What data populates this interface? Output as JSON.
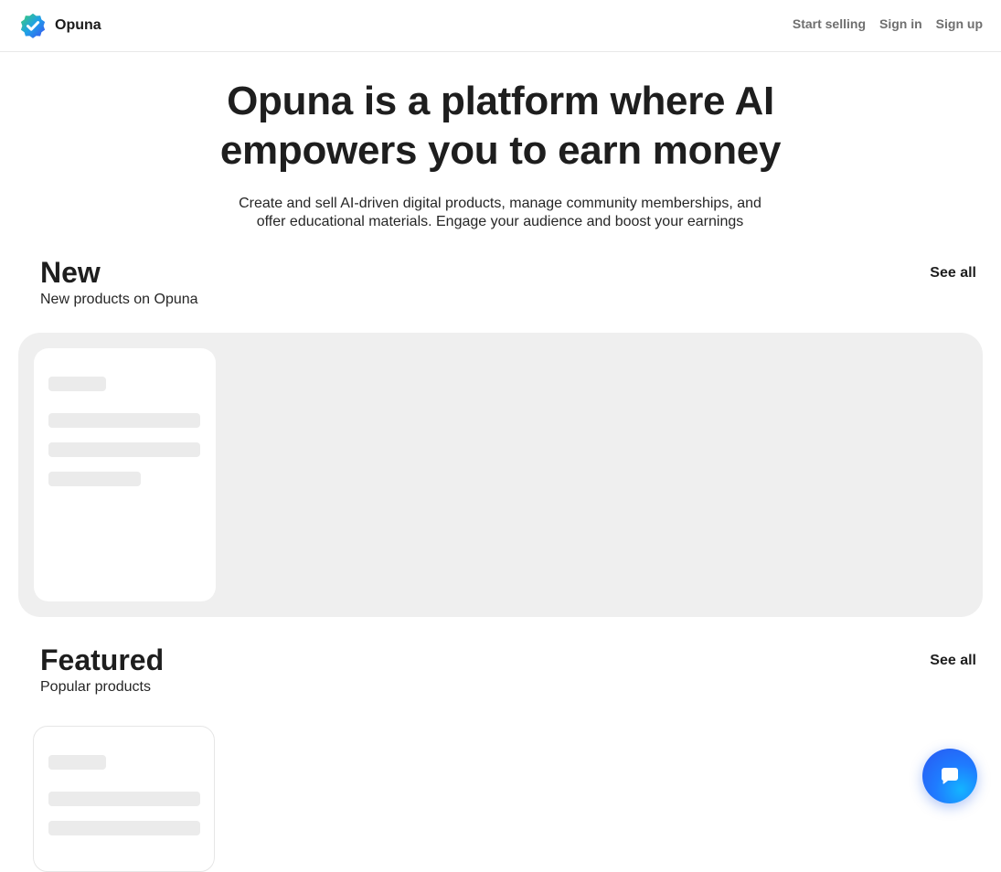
{
  "header": {
    "brand_name": "Opuna",
    "nav": {
      "start_selling": "Start selling",
      "sign_in": "Sign in",
      "sign_up": "Sign up"
    }
  },
  "hero": {
    "title_line1": "Opuna is a platform where AI",
    "title_line2": "empowers you to earn money",
    "subtitle_line1": "Create and sell AI-driven digital products, manage community memberships, and",
    "subtitle_line2": "offer educational materials. Engage your audience and boost your earnings"
  },
  "sections": {
    "new": {
      "title": "New",
      "description": "New products on Opuna",
      "see_all": "See all"
    },
    "featured": {
      "title": "Featured",
      "description": "Popular products",
      "see_all": "See all"
    }
  },
  "icons": {
    "logo": "verified-badge-icon",
    "chat": "chat-bubble-icon"
  },
  "colors": {
    "brand_blue": "#2a56f0",
    "brand_cyan": "#14b4ff",
    "logo_green": "#2fc47a",
    "panel_gray": "#efefef",
    "skeleton": "#ebebeb"
  }
}
